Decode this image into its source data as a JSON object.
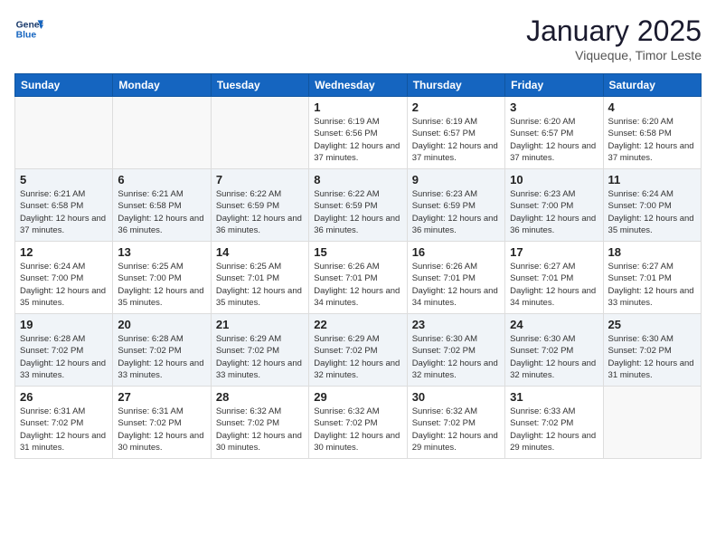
{
  "header": {
    "logo_line1": "General",
    "logo_line2": "Blue",
    "month_title": "January 2025",
    "location": "Viqueque, Timor Leste"
  },
  "weekdays": [
    "Sunday",
    "Monday",
    "Tuesday",
    "Wednesday",
    "Thursday",
    "Friday",
    "Saturday"
  ],
  "weeks": [
    [
      {
        "day": "",
        "sunrise": "",
        "sunset": "",
        "daylight": ""
      },
      {
        "day": "",
        "sunrise": "",
        "sunset": "",
        "daylight": ""
      },
      {
        "day": "",
        "sunrise": "",
        "sunset": "",
        "daylight": ""
      },
      {
        "day": "1",
        "sunrise": "Sunrise: 6:19 AM",
        "sunset": "Sunset: 6:56 PM",
        "daylight": "Daylight: 12 hours and 37 minutes."
      },
      {
        "day": "2",
        "sunrise": "Sunrise: 6:19 AM",
        "sunset": "Sunset: 6:57 PM",
        "daylight": "Daylight: 12 hours and 37 minutes."
      },
      {
        "day": "3",
        "sunrise": "Sunrise: 6:20 AM",
        "sunset": "Sunset: 6:57 PM",
        "daylight": "Daylight: 12 hours and 37 minutes."
      },
      {
        "day": "4",
        "sunrise": "Sunrise: 6:20 AM",
        "sunset": "Sunset: 6:58 PM",
        "daylight": "Daylight: 12 hours and 37 minutes."
      }
    ],
    [
      {
        "day": "5",
        "sunrise": "Sunrise: 6:21 AM",
        "sunset": "Sunset: 6:58 PM",
        "daylight": "Daylight: 12 hours and 37 minutes."
      },
      {
        "day": "6",
        "sunrise": "Sunrise: 6:21 AM",
        "sunset": "Sunset: 6:58 PM",
        "daylight": "Daylight: 12 hours and 36 minutes."
      },
      {
        "day": "7",
        "sunrise": "Sunrise: 6:22 AM",
        "sunset": "Sunset: 6:59 PM",
        "daylight": "Daylight: 12 hours and 36 minutes."
      },
      {
        "day": "8",
        "sunrise": "Sunrise: 6:22 AM",
        "sunset": "Sunset: 6:59 PM",
        "daylight": "Daylight: 12 hours and 36 minutes."
      },
      {
        "day": "9",
        "sunrise": "Sunrise: 6:23 AM",
        "sunset": "Sunset: 6:59 PM",
        "daylight": "Daylight: 12 hours and 36 minutes."
      },
      {
        "day": "10",
        "sunrise": "Sunrise: 6:23 AM",
        "sunset": "Sunset: 7:00 PM",
        "daylight": "Daylight: 12 hours and 36 minutes."
      },
      {
        "day": "11",
        "sunrise": "Sunrise: 6:24 AM",
        "sunset": "Sunset: 7:00 PM",
        "daylight": "Daylight: 12 hours and 35 minutes."
      }
    ],
    [
      {
        "day": "12",
        "sunrise": "Sunrise: 6:24 AM",
        "sunset": "Sunset: 7:00 PM",
        "daylight": "Daylight: 12 hours and 35 minutes."
      },
      {
        "day": "13",
        "sunrise": "Sunrise: 6:25 AM",
        "sunset": "Sunset: 7:00 PM",
        "daylight": "Daylight: 12 hours and 35 minutes."
      },
      {
        "day": "14",
        "sunrise": "Sunrise: 6:25 AM",
        "sunset": "Sunset: 7:01 PM",
        "daylight": "Daylight: 12 hours and 35 minutes."
      },
      {
        "day": "15",
        "sunrise": "Sunrise: 6:26 AM",
        "sunset": "Sunset: 7:01 PM",
        "daylight": "Daylight: 12 hours and 34 minutes."
      },
      {
        "day": "16",
        "sunrise": "Sunrise: 6:26 AM",
        "sunset": "Sunset: 7:01 PM",
        "daylight": "Daylight: 12 hours and 34 minutes."
      },
      {
        "day": "17",
        "sunrise": "Sunrise: 6:27 AM",
        "sunset": "Sunset: 7:01 PM",
        "daylight": "Daylight: 12 hours and 34 minutes."
      },
      {
        "day": "18",
        "sunrise": "Sunrise: 6:27 AM",
        "sunset": "Sunset: 7:01 PM",
        "daylight": "Daylight: 12 hours and 33 minutes."
      }
    ],
    [
      {
        "day": "19",
        "sunrise": "Sunrise: 6:28 AM",
        "sunset": "Sunset: 7:02 PM",
        "daylight": "Daylight: 12 hours and 33 minutes."
      },
      {
        "day": "20",
        "sunrise": "Sunrise: 6:28 AM",
        "sunset": "Sunset: 7:02 PM",
        "daylight": "Daylight: 12 hours and 33 minutes."
      },
      {
        "day": "21",
        "sunrise": "Sunrise: 6:29 AM",
        "sunset": "Sunset: 7:02 PM",
        "daylight": "Daylight: 12 hours and 33 minutes."
      },
      {
        "day": "22",
        "sunrise": "Sunrise: 6:29 AM",
        "sunset": "Sunset: 7:02 PM",
        "daylight": "Daylight: 12 hours and 32 minutes."
      },
      {
        "day": "23",
        "sunrise": "Sunrise: 6:30 AM",
        "sunset": "Sunset: 7:02 PM",
        "daylight": "Daylight: 12 hours and 32 minutes."
      },
      {
        "day": "24",
        "sunrise": "Sunrise: 6:30 AM",
        "sunset": "Sunset: 7:02 PM",
        "daylight": "Daylight: 12 hours and 32 minutes."
      },
      {
        "day": "25",
        "sunrise": "Sunrise: 6:30 AM",
        "sunset": "Sunset: 7:02 PM",
        "daylight": "Daylight: 12 hours and 31 minutes."
      }
    ],
    [
      {
        "day": "26",
        "sunrise": "Sunrise: 6:31 AM",
        "sunset": "Sunset: 7:02 PM",
        "daylight": "Daylight: 12 hours and 31 minutes."
      },
      {
        "day": "27",
        "sunrise": "Sunrise: 6:31 AM",
        "sunset": "Sunset: 7:02 PM",
        "daylight": "Daylight: 12 hours and 30 minutes."
      },
      {
        "day": "28",
        "sunrise": "Sunrise: 6:32 AM",
        "sunset": "Sunset: 7:02 PM",
        "daylight": "Daylight: 12 hours and 30 minutes."
      },
      {
        "day": "29",
        "sunrise": "Sunrise: 6:32 AM",
        "sunset": "Sunset: 7:02 PM",
        "daylight": "Daylight: 12 hours and 30 minutes."
      },
      {
        "day": "30",
        "sunrise": "Sunrise: 6:32 AM",
        "sunset": "Sunset: 7:02 PM",
        "daylight": "Daylight: 12 hours and 29 minutes."
      },
      {
        "day": "31",
        "sunrise": "Sunrise: 6:33 AM",
        "sunset": "Sunset: 7:02 PM",
        "daylight": "Daylight: 12 hours and 29 minutes."
      },
      {
        "day": "",
        "sunrise": "",
        "sunset": "",
        "daylight": ""
      }
    ]
  ]
}
